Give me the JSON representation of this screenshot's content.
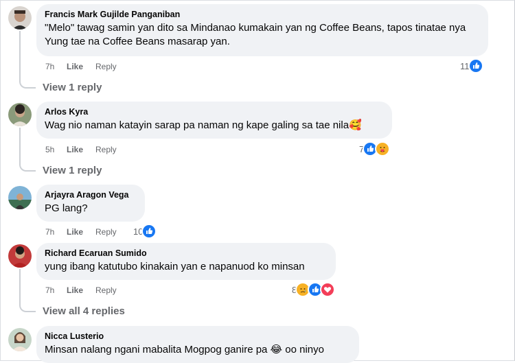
{
  "comments": [
    {
      "author": "Francis Mark Gujilde Panganiban",
      "text": "\"Melo\" tawag samin yan dito sa Mindanao kumakain yan ng Coffee Beans, tapos tinatae nya Yung tae na Coffee Beans masarap yan.",
      "time": "7h",
      "like_label": "Like",
      "reply_label": "Reply",
      "reaction_count": "11",
      "reactions": [
        "like-icon"
      ],
      "view_replies": "View 1 reply"
    },
    {
      "author": "Arlos Kyra",
      "text": "Wag nio naman katayin sarap pa naman ng kape galing sa tae nila🥰",
      "time": "5h",
      "like_label": "Like",
      "reply_label": "Reply",
      "reaction_count": "7",
      "reactions": [
        "like-icon",
        "care-icon"
      ],
      "view_replies": "View 1 reply"
    },
    {
      "author": "Arjayra Aragon Vega",
      "text": "PG lang?",
      "time": "7h",
      "like_label": "Like",
      "reply_label": "Reply",
      "reaction_count": "10",
      "reactions": [
        "like-icon"
      ]
    },
    {
      "author": "Richard Ecaruan Sumido",
      "text": "yung ibang katutubo kinakain yan e napanuod ko minsan",
      "time": "7h",
      "like_label": "Like",
      "reply_label": "Reply",
      "reaction_count": "8",
      "reactions": [
        "sad-icon",
        "like-icon",
        "love-icon"
      ],
      "view_replies": "View all 4 replies"
    },
    {
      "author": "Nicca Lusterio",
      "text": "Minsan nalang ngani mabalita Mogpog ganire pa 😂 oo ninyo"
    }
  ],
  "colors": {
    "bubble": "#f0f2f5",
    "meta_text": "#65676b",
    "like_blue": "#1877f2",
    "love_red": "#f33e58",
    "thread_line": "#ccd0d5"
  }
}
